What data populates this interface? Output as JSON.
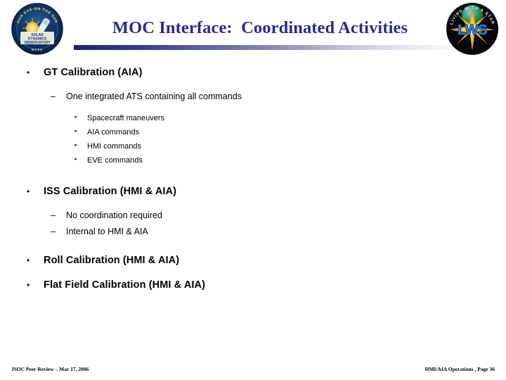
{
  "slide": {
    "title": "MOC Interface:  Coordinated Activities",
    "title_color": "#2a2a8c",
    "background_color": "#ffffff",
    "rule_gradient_start": "#20207a",
    "rule_gradient_end": "#fbfbfd"
  },
  "logos": {
    "left": {
      "name": "sdo-mission-patch",
      "arc_text": "OUR EYE ON THE SUN",
      "banner_line1": "SOLAR",
      "banner_line2": "DYNAMICS",
      "banner_line3": "OBSERVATORY",
      "footer_text": "NASA"
    },
    "right": {
      "name": "lws-mission-patch",
      "arc_text": "LIVING WITH A STAR",
      "acronym": "LWS"
    }
  },
  "content": {
    "sections": [
      {
        "heading": "GT Calibration (AIA)",
        "sub_bullets": [
          {
            "text": "One integrated ATS containing all commands",
            "items": [
              "Spacecraft maneuvers",
              "AIA commands",
              "HMI commands",
              "EVE commands"
            ]
          }
        ]
      },
      {
        "heading": "ISS Calibration (HMI & AIA)",
        "sub_bullets": [
          {
            "text": "No coordination required",
            "items": []
          },
          {
            "text": "Internal to HMI & AIA",
            "items": []
          }
        ]
      },
      {
        "heading": "Roll Calibration (HMI & AIA)",
        "sub_bullets": []
      },
      {
        "heading": "Flat Field Calibration (HMI & AIA)",
        "sub_bullets": []
      }
    ]
  },
  "bullets": {
    "level1_glyph": "•",
    "level2_glyph": "–",
    "level3_glyph": "▪"
  },
  "footer": {
    "left": "JSOC Peer Review – Mar 17, 2006",
    "right": "HMI/AIA Operations , Page 36"
  }
}
